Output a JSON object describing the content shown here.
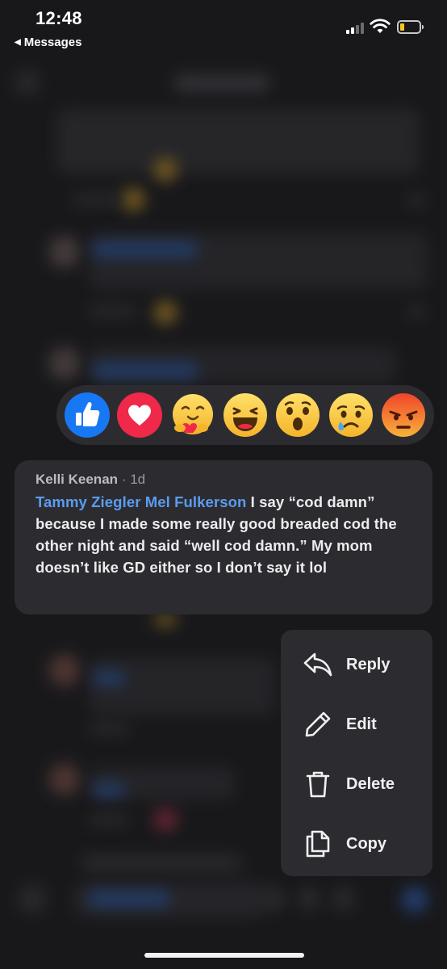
{
  "status_bar": {
    "time": "12:48",
    "back_app": "Messages",
    "battery_color": "#f2c81a"
  },
  "reactions": [
    {
      "name": "Like",
      "icon": "like-icon"
    },
    {
      "name": "Love",
      "icon": "love-icon"
    },
    {
      "name": "Care",
      "icon": "care-icon"
    },
    {
      "name": "Haha",
      "icon": "haha-icon"
    },
    {
      "name": "Wow",
      "icon": "wow-icon"
    },
    {
      "name": "Sad",
      "icon": "sad-icon"
    },
    {
      "name": "Angry",
      "icon": "angry-icon"
    }
  ],
  "comment": {
    "author": "Kelli Keenan",
    "separator": "·",
    "age": "1d",
    "mention": "Tammy Ziegler Mel Fulkerson",
    "text": " I say “cod damn” because I made some really good breaded cod the other night and said “well cod damn.” My mom doesn’t like GD either so I don’t say it lol"
  },
  "menu": {
    "reply": "Reply",
    "edit": "Edit",
    "delete": "Delete",
    "copy": "Copy"
  },
  "colors": {
    "accent_blue": "#5a9cf0",
    "like_blue": "#1877f2",
    "love_red": "#f0284a"
  }
}
